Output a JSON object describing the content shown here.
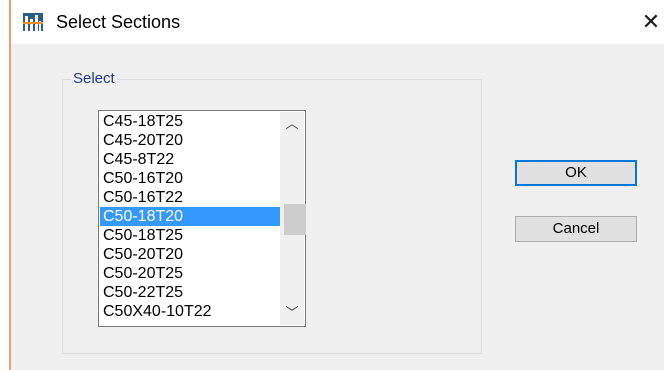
{
  "window": {
    "title": "Select Sections",
    "close_glyph": "✕"
  },
  "group": {
    "label": "Select"
  },
  "sections": {
    "items": [
      "C45-18T25",
      "C45-20T20",
      "C45-8T22",
      "C50-16T20",
      "C50-16T22",
      "C50-18T20",
      "C50-18T25",
      "C50-20T20",
      "C50-20T25",
      "C50-22T25",
      "C50X40-10T22"
    ],
    "selected": "C50-18T20"
  },
  "scrollbar": {
    "up_glyph": "︿",
    "down_glyph": "﹀"
  },
  "buttons": {
    "ok_label": "OK",
    "cancel_label": "Cancel"
  },
  "colors": {
    "selection": "#3399ff",
    "group_label": "#1f3a93",
    "default_button_border": "#0078d7"
  }
}
